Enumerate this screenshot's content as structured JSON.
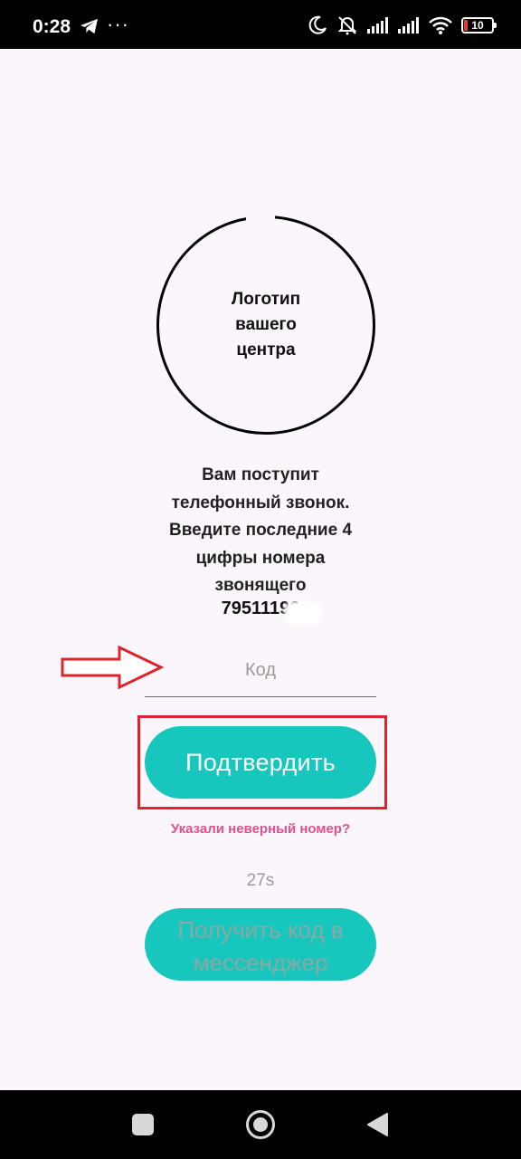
{
  "status_bar": {
    "time": "0:28",
    "more": "···",
    "battery": "10",
    "icons": [
      "telegram-icon",
      "more-icon",
      "moon-icon",
      "alarm-off-icon",
      "signal-icon",
      "signal-icon",
      "wifi-icon",
      "battery-icon"
    ]
  },
  "logo": {
    "text": "Логотип\nвашего\nцентра"
  },
  "instruction": {
    "text": "Вам поступит\nтелефонный звонок.\nВведите последние 4\nцифры номера\nзвонящего",
    "phone": "79511196"
  },
  "code_input": {
    "placeholder": "Код",
    "value": ""
  },
  "buttons": {
    "confirm_label": "Подтвердить",
    "wrong_number_label": "Указали неверный номер?",
    "timer": "27s",
    "messenger_label": "Получить код в\nмессенджер"
  },
  "colors": {
    "accent": "#17c6bc",
    "link": "#e0508c",
    "annotation": "#e0232b",
    "background": "#fbf6fc"
  },
  "nav_bar": {
    "icons": [
      "recent-apps-icon",
      "home-icon",
      "back-icon"
    ]
  }
}
